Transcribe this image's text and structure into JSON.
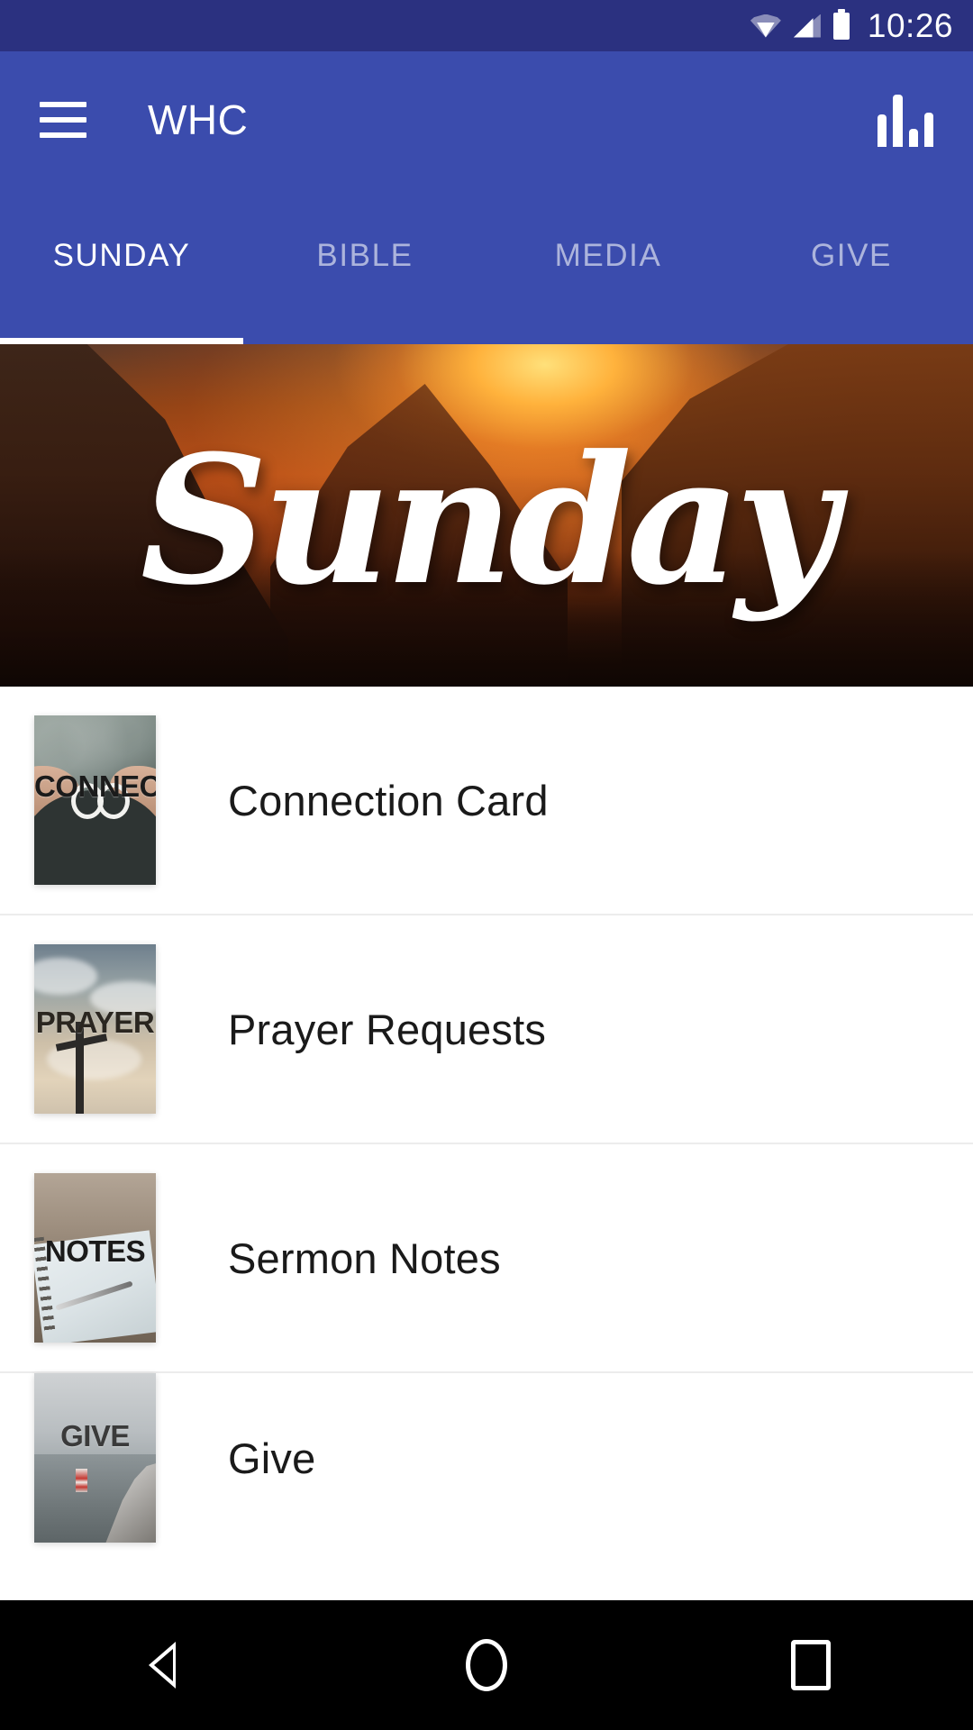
{
  "status_bar": {
    "time": "10:26",
    "icons": [
      "wifi-icon",
      "cell-signal-icon",
      "battery-icon"
    ],
    "background_color": "#2b3180"
  },
  "app_bar": {
    "menu_icon": "hamburger-menu-icon",
    "title": "WHC",
    "action_icon": "bar-chart-icon",
    "background_color": "#3b4cad"
  },
  "tabs": {
    "active_index": 0,
    "items": [
      {
        "label": "SUNDAY"
      },
      {
        "label": "BIBLE"
      },
      {
        "label": "MEDIA"
      },
      {
        "label": "GIVE"
      }
    ],
    "indicator_color": "#ffffff"
  },
  "hero": {
    "script_text": "Sunday",
    "description": "autumn-mountain-sunset-banner"
  },
  "list": {
    "items": [
      {
        "thumb_caption": "CONNECT",
        "label": "Connection Card"
      },
      {
        "thumb_caption": "PRAYER",
        "label": "Prayer Requests"
      },
      {
        "thumb_caption": "NOTES",
        "label": "Sermon Notes"
      },
      {
        "thumb_caption": "GIVE",
        "label": "Give"
      }
    ]
  },
  "nav_bar": {
    "back": "back-triangle-icon",
    "home": "home-circle-icon",
    "recents": "recents-square-icon",
    "background_color": "#000000"
  }
}
